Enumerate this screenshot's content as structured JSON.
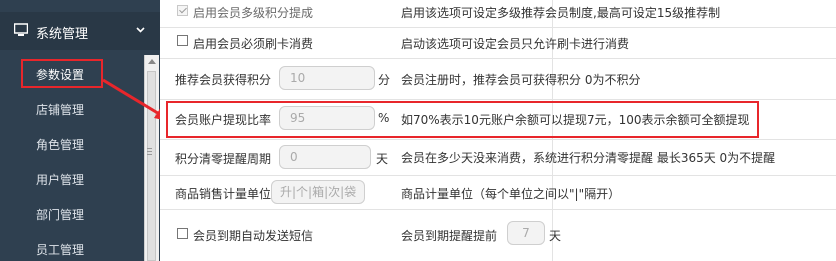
{
  "sidebar": {
    "section_title": "系统管理",
    "items": [
      {
        "label": "参数设置"
      },
      {
        "label": "店铺管理"
      },
      {
        "label": "角色管理"
      },
      {
        "label": "用户管理"
      },
      {
        "label": "部门管理"
      },
      {
        "label": "员工管理"
      }
    ]
  },
  "settings": {
    "multilevel": {
      "label": "启用会员多级积分提成",
      "desc": "启用该选项可设定多级推荐会员制度,最高可设定15级推荐制"
    },
    "card_required": {
      "label": "启用会员必须刷卡消费",
      "desc": "启动该选项可设定会员只允许刷卡进行消费"
    },
    "referral_points": {
      "label": "推荐会员获得积分",
      "value": "10",
      "unit": "分",
      "desc": "会员注册时，推荐会员可获得积分 0为不积分"
    },
    "withdraw_ratio": {
      "label": "会员账户提现比率",
      "value": "95",
      "unit": "%",
      "desc": "如70%表示10元账户余额可以提现7元，100表示余额可全额提现"
    },
    "points_clear": {
      "label": "积分清零提醒周期",
      "value": "0",
      "unit": "天",
      "desc": "会员在多少天没来消费，系统进行积分清零提醒 最长365天 0为不提醒"
    },
    "sales_unit": {
      "label": "商品销售计量单位",
      "value": "升|个|箱|次|袋",
      "desc": "商品计量单位（每个单位之间以\"|\"隔开）"
    },
    "expiry_sms": {
      "label": "会员到期自动发送短信",
      "desc_prefix": "会员到期提醒提前",
      "value": "7",
      "unit": "天"
    }
  },
  "colors": {
    "sidebar_bg": "#2f4050",
    "highlight": "#e8262b"
  }
}
